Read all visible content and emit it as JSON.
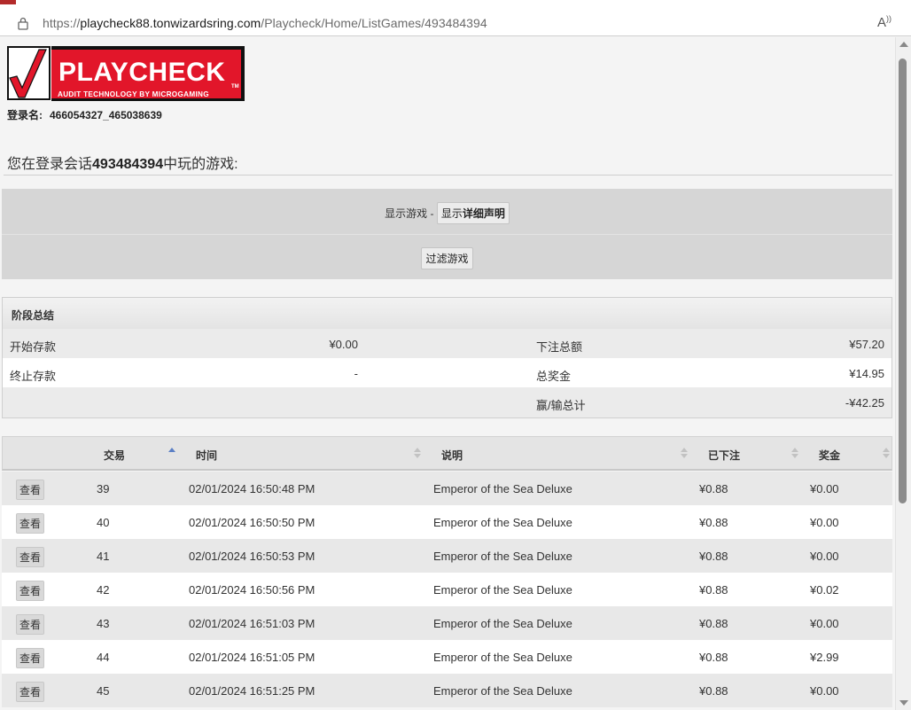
{
  "browser": {
    "url_prefix": "https://",
    "url_host": "playcheck88.tonwizardsring.com",
    "url_path": "/Playcheck/Home/ListGames/493484394",
    "read_aloud_icon": "read-aloud-icon"
  },
  "header": {
    "logo_text": "PLAYCHECK",
    "logo_tagline": "AUDIT TECHNOLOGY BY MICROGAMING",
    "logo_tm": "TM",
    "login_label": "登录名:",
    "login_value": "466054327_465038639"
  },
  "session": {
    "prefix": "您在登录会话",
    "id": "493484394",
    "suffix": "中玩的游戏:"
  },
  "filters": {
    "show_games_label": "显示游戏 -",
    "detail_button_prefix": "显示",
    "detail_button_bold": "详细声明",
    "filter_button": "过滤游戏"
  },
  "summary": {
    "title": "阶段总结",
    "rows": [
      {
        "label1": "开始存款",
        "value1": "¥0.00",
        "label2": "下注总额",
        "value2": "¥57.20"
      },
      {
        "label1": "终止存款",
        "value1": "-",
        "label2": "总奖金",
        "value2": "¥14.95"
      },
      {
        "label1": "",
        "value1": "",
        "label2": "赢/输总计",
        "value2": "-¥42.25"
      }
    ]
  },
  "table": {
    "columns": [
      "交易",
      "时间",
      "说明",
      "已下注",
      "奖金"
    ],
    "view_label": "查看",
    "rows": [
      {
        "txn": "39",
        "time": "02/01/2024 16:50:48 PM",
        "desc": "Emperor of the Sea Deluxe",
        "bet": "¥0.88",
        "win": "¥0.00"
      },
      {
        "txn": "40",
        "time": "02/01/2024 16:50:50 PM",
        "desc": "Emperor of the Sea Deluxe",
        "bet": "¥0.88",
        "win": "¥0.00"
      },
      {
        "txn": "41",
        "time": "02/01/2024 16:50:53 PM",
        "desc": "Emperor of the Sea Deluxe",
        "bet": "¥0.88",
        "win": "¥0.00"
      },
      {
        "txn": "42",
        "time": "02/01/2024 16:50:56 PM",
        "desc": "Emperor of the Sea Deluxe",
        "bet": "¥0.88",
        "win": "¥0.02"
      },
      {
        "txn": "43",
        "time": "02/01/2024 16:51:03 PM",
        "desc": "Emperor of the Sea Deluxe",
        "bet": "¥0.88",
        "win": "¥0.00"
      },
      {
        "txn": "44",
        "time": "02/01/2024 16:51:05 PM",
        "desc": "Emperor of the Sea Deluxe",
        "bet": "¥0.88",
        "win": "¥2.99"
      },
      {
        "txn": "45",
        "time": "02/01/2024 16:51:25 PM",
        "desc": "Emperor of the Sea Deluxe",
        "bet": "¥0.88",
        "win": "¥0.00"
      }
    ]
  },
  "colors": {
    "logo_red": "#e2162a",
    "logo_black": "#111111",
    "sort_active": "#5b7fc5"
  }
}
